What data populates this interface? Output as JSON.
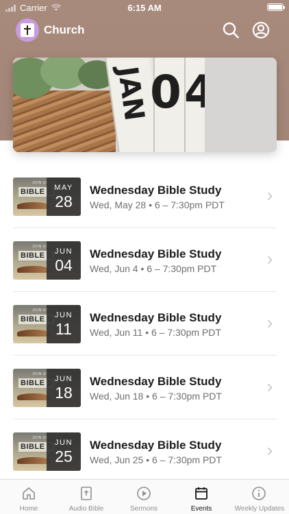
{
  "status_bar": {
    "carrier": "Carrier",
    "time": "6:15 AM"
  },
  "app": {
    "title": "Church"
  },
  "hero": {
    "text_left": "JAN",
    "text_right": "04"
  },
  "events": [
    {
      "thumb_word": "BIBLE S",
      "thumb_caption": "JOIN US FOR",
      "month": "MAY",
      "day": "28",
      "title": "Wednesday Bible Study",
      "subtitle": "Wed, May 28 • 6 – 7:30pm PDT"
    },
    {
      "thumb_word": "BIBLE S",
      "thumb_caption": "JOIN US FOR",
      "month": "JUN",
      "day": "04",
      "title": "Wednesday Bible Study",
      "subtitle": "Wed, Jun 4 • 6 – 7:30pm PDT"
    },
    {
      "thumb_word": "BIBLE S",
      "thumb_caption": "JOIN US FOR",
      "month": "JUN",
      "day": "11",
      "title": "Wednesday Bible Study",
      "subtitle": "Wed, Jun 11 • 6 – 7:30pm PDT"
    },
    {
      "thumb_word": "BIBLE S",
      "thumb_caption": "JOIN US FOR",
      "month": "JUN",
      "day": "18",
      "title": "Wednesday Bible Study",
      "subtitle": "Wed, Jun 18 • 6 – 7:30pm PDT"
    },
    {
      "thumb_word": "BIBLE S",
      "thumb_caption": "JOIN US FOR",
      "month": "JUN",
      "day": "25",
      "title": "Wednesday Bible Study",
      "subtitle": "Wed, Jun 25 • 6 – 7:30pm PDT"
    }
  ],
  "tabs": [
    {
      "label": "Home",
      "icon": "home-icon"
    },
    {
      "label": "Audio Bible",
      "icon": "bible-icon"
    },
    {
      "label": "Sermons",
      "icon": "play-icon"
    },
    {
      "label": "Events",
      "icon": "calendar-icon",
      "active": true
    },
    {
      "label": "Weekly Updates",
      "icon": "info-icon"
    }
  ],
  "colors": {
    "header_bg": "#a88a7d",
    "logo_bg": "#c89de0",
    "active_tab": "#111111",
    "inactive_tab": "#8e8e8e"
  }
}
